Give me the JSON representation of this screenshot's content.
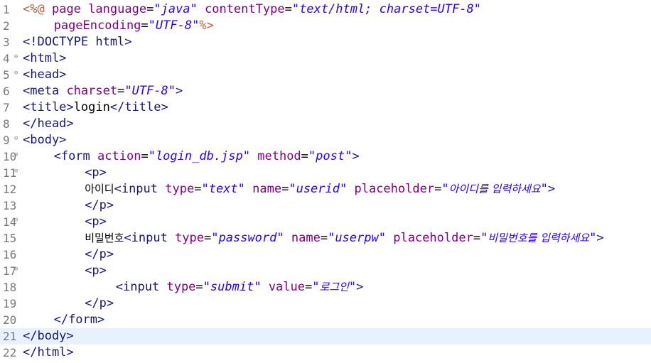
{
  "editor": {
    "current_line": 21,
    "lines": [
      {
        "num": "1",
        "fold": false,
        "indent": 0,
        "tokens": [
          {
            "t": "jsp",
            "v": "<%@"
          },
          {
            "t": "txt",
            "v": " "
          },
          {
            "t": "attr",
            "v": "page"
          },
          {
            "t": "txt",
            "v": " "
          },
          {
            "t": "attr",
            "v": "language"
          },
          {
            "t": "txt",
            "v": "="
          },
          {
            "t": "str",
            "v": "\"java\""
          },
          {
            "t": "txt",
            "v": " "
          },
          {
            "t": "attr",
            "v": "contentType"
          },
          {
            "t": "txt",
            "v": "="
          },
          {
            "t": "str",
            "v": "\"text/html; charset=UTF-8\""
          }
        ]
      },
      {
        "num": "2",
        "fold": false,
        "indent": 4,
        "tokens": [
          {
            "t": "attr",
            "v": "pageEncoding"
          },
          {
            "t": "txt",
            "v": "="
          },
          {
            "t": "str",
            "v": "\"UTF-8\""
          },
          {
            "t": "jsp",
            "v": "%>"
          }
        ]
      },
      {
        "num": "3",
        "fold": false,
        "indent": 0,
        "tokens": [
          {
            "t": "tag",
            "v": "<!DOCTYPE html>"
          }
        ]
      },
      {
        "num": "4",
        "fold": true,
        "indent": 0,
        "tokens": [
          {
            "t": "tag",
            "v": "<html>"
          }
        ]
      },
      {
        "num": "5",
        "fold": true,
        "indent": 0,
        "tokens": [
          {
            "t": "tag",
            "v": "<head>"
          }
        ]
      },
      {
        "num": "6",
        "fold": false,
        "indent": 0,
        "tokens": [
          {
            "t": "tag",
            "v": "<meta"
          },
          {
            "t": "txt",
            "v": " "
          },
          {
            "t": "attr",
            "v": "charset"
          },
          {
            "t": "txt",
            "v": "="
          },
          {
            "t": "str",
            "v": "\"UTF-8\""
          },
          {
            "t": "tag",
            "v": ">"
          }
        ]
      },
      {
        "num": "7",
        "fold": false,
        "indent": 0,
        "tokens": [
          {
            "t": "tag",
            "v": "<title>"
          },
          {
            "t": "txt",
            "v": "login"
          },
          {
            "t": "tag",
            "v": "</title>"
          }
        ]
      },
      {
        "num": "8",
        "fold": false,
        "indent": 0,
        "tokens": [
          {
            "t": "tag",
            "v": "</head>"
          }
        ]
      },
      {
        "num": "9",
        "fold": true,
        "indent": 0,
        "tokens": [
          {
            "t": "tag",
            "v": "<body>"
          }
        ]
      },
      {
        "num": "10",
        "fold": true,
        "indent": 4,
        "tokens": [
          {
            "t": "tag",
            "v": "<form"
          },
          {
            "t": "txt",
            "v": " "
          },
          {
            "t": "attr",
            "v": "action"
          },
          {
            "t": "txt",
            "v": "="
          },
          {
            "t": "str",
            "v": "\"login_db.jsp\""
          },
          {
            "t": "txt",
            "v": " "
          },
          {
            "t": "attr",
            "v": "method"
          },
          {
            "t": "txt",
            "v": "="
          },
          {
            "t": "str",
            "v": "\"post\""
          },
          {
            "t": "tag",
            "v": ">"
          }
        ]
      },
      {
        "num": "11",
        "fold": true,
        "indent": 8,
        "tokens": [
          {
            "t": "tag",
            "v": "<p>"
          }
        ]
      },
      {
        "num": "12",
        "fold": false,
        "indent": 8,
        "tokens": [
          {
            "t": "txt ko",
            "v": "아이디"
          },
          {
            "t": "tag",
            "v": "<input"
          },
          {
            "t": "txt",
            "v": " "
          },
          {
            "t": "attr",
            "v": "type"
          },
          {
            "t": "txt",
            "v": "="
          },
          {
            "t": "str",
            "v": "\"text\""
          },
          {
            "t": "txt",
            "v": " "
          },
          {
            "t": "attr",
            "v": "name"
          },
          {
            "t": "txt",
            "v": "="
          },
          {
            "t": "str",
            "v": "\"userid\""
          },
          {
            "t": "txt",
            "v": " "
          },
          {
            "t": "attr",
            "v": "placeholder"
          },
          {
            "t": "txt",
            "v": "="
          },
          {
            "t": "str",
            "v": "\""
          },
          {
            "t": "str ko",
            "v": "아이디를 입력하세요"
          },
          {
            "t": "str",
            "v": "\""
          },
          {
            "t": "tag",
            "v": ">"
          }
        ]
      },
      {
        "num": "13",
        "fold": false,
        "indent": 8,
        "tokens": [
          {
            "t": "tag",
            "v": "</p>"
          }
        ]
      },
      {
        "num": "14",
        "fold": true,
        "indent": 8,
        "tokens": [
          {
            "t": "tag",
            "v": "<p>"
          }
        ]
      },
      {
        "num": "15",
        "fold": false,
        "indent": 8,
        "tokens": [
          {
            "t": "txt ko",
            "v": "비밀번호"
          },
          {
            "t": "tag",
            "v": "<input"
          },
          {
            "t": "txt",
            "v": " "
          },
          {
            "t": "attr",
            "v": "type"
          },
          {
            "t": "txt",
            "v": "="
          },
          {
            "t": "str",
            "v": "\"password\""
          },
          {
            "t": "txt",
            "v": " "
          },
          {
            "t": "attr",
            "v": "name"
          },
          {
            "t": "txt",
            "v": "="
          },
          {
            "t": "str",
            "v": "\"userpw\""
          },
          {
            "t": "txt",
            "v": " "
          },
          {
            "t": "attr",
            "v": "placeholder"
          },
          {
            "t": "txt",
            "v": "="
          },
          {
            "t": "str",
            "v": "\""
          },
          {
            "t": "str ko",
            "v": "비밀번호를 입력하세요"
          },
          {
            "t": "str",
            "v": "\""
          },
          {
            "t": "tag",
            "v": ">"
          }
        ]
      },
      {
        "num": "16",
        "fold": false,
        "indent": 8,
        "tokens": [
          {
            "t": "tag",
            "v": "</p>"
          }
        ]
      },
      {
        "num": "17",
        "fold": true,
        "indent": 8,
        "tokens": [
          {
            "t": "tag",
            "v": "<p>"
          }
        ]
      },
      {
        "num": "18",
        "fold": false,
        "indent": 12,
        "tokens": [
          {
            "t": "tag",
            "v": "<input"
          },
          {
            "t": "txt",
            "v": " "
          },
          {
            "t": "attr",
            "v": "type"
          },
          {
            "t": "txt",
            "v": "="
          },
          {
            "t": "str",
            "v": "\"submit\""
          },
          {
            "t": "txt",
            "v": " "
          },
          {
            "t": "attr",
            "v": "value"
          },
          {
            "t": "txt",
            "v": "="
          },
          {
            "t": "str",
            "v": "\""
          },
          {
            "t": "str ko",
            "v": "로그인"
          },
          {
            "t": "str",
            "v": "\""
          },
          {
            "t": "tag",
            "v": ">"
          }
        ]
      },
      {
        "num": "19",
        "fold": false,
        "indent": 8,
        "tokens": [
          {
            "t": "tag",
            "v": "</p>"
          }
        ]
      },
      {
        "num": "20",
        "fold": false,
        "indent": 4,
        "tokens": [
          {
            "t": "tag",
            "v": "</form>"
          }
        ]
      },
      {
        "num": "21",
        "fold": false,
        "indent": 0,
        "tokens": [
          {
            "t": "tag",
            "v": "</body>"
          }
        ]
      },
      {
        "num": "22",
        "fold": false,
        "indent": 0,
        "tokens": [
          {
            "t": "tag",
            "v": "</html>"
          }
        ]
      }
    ]
  }
}
